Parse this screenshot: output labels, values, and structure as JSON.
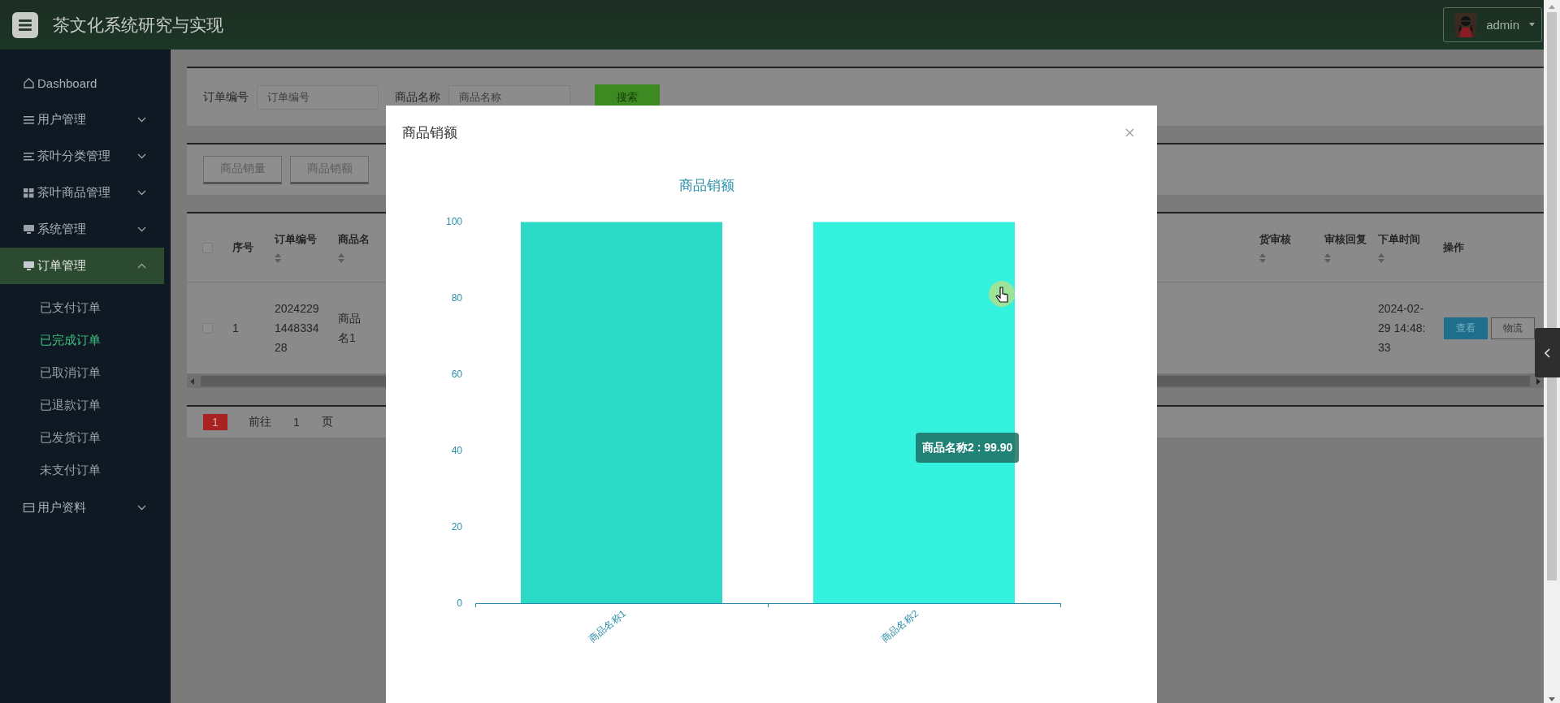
{
  "header": {
    "title": "茶文化系统研究与实现",
    "user": "admin"
  },
  "sidebar": {
    "items": [
      {
        "label": "Dashboard",
        "kind": "link",
        "selected": false
      },
      {
        "label": "用户管理",
        "kind": "group",
        "expanded": false,
        "selected": false
      },
      {
        "label": "茶叶分类管理",
        "kind": "group",
        "expanded": false,
        "selected": false
      },
      {
        "label": "茶叶商品管理",
        "kind": "group",
        "expanded": false,
        "selected": false
      },
      {
        "label": "系统管理",
        "kind": "group",
        "expanded": false,
        "selected": false
      },
      {
        "label": "订单管理",
        "kind": "group",
        "expanded": true,
        "selected": true,
        "children": [
          {
            "label": "已支付订单",
            "selected": false
          },
          {
            "label": "已完成订单",
            "selected": true
          },
          {
            "label": "已取消订单",
            "selected": false
          },
          {
            "label": "已退款订单",
            "selected": false
          },
          {
            "label": "已发货订单",
            "selected": false
          },
          {
            "label": "未支付订单",
            "selected": false
          }
        ]
      },
      {
        "label": "用户资料",
        "kind": "group",
        "expanded": false,
        "selected": false
      }
    ]
  },
  "search": {
    "fields": [
      {
        "label": "订单编号",
        "placeholder": "订单编号"
      },
      {
        "label": "商品名称",
        "placeholder": "商品名称"
      }
    ],
    "button": "搜索"
  },
  "chart_buttons": [
    "商品销量",
    "商品销额"
  ],
  "table": {
    "header_checked": false,
    "columns": [
      {
        "label": "序号",
        "sortable": false
      },
      {
        "label": "订单编号",
        "sortable": true
      },
      {
        "label": "商品名",
        "sortable": true
      },
      {
        "label": "货审核",
        "sortable": true
      },
      {
        "label": "审核回复",
        "sortable": true
      },
      {
        "label": "下单时间",
        "sortable": true
      },
      {
        "label": "操作",
        "sortable": false
      }
    ],
    "rows": [
      {
        "checked": false,
        "cells": [
          "1",
          "2024229144833428",
          "商品名1",
          "",
          "",
          "2024-02-29 14:48:33"
        ],
        "actions": [
          "查看",
          "物流"
        ]
      }
    ]
  },
  "pagination": {
    "current": "1",
    "goto_label": "前往",
    "page_input": "1",
    "page_suffix": "页"
  },
  "modal": {
    "title": "商品销额",
    "tooltip": "商品名称2 : 99.90",
    "chart_data": {
      "type": "bar",
      "title": "商品销额",
      "categories": [
        "商品名称1",
        "商品名称2"
      ],
      "values": [
        99.9,
        99.9
      ],
      "ylim": [
        0,
        100
      ],
      "yticks": [
        0,
        20,
        40,
        60,
        80,
        100
      ]
    }
  }
}
